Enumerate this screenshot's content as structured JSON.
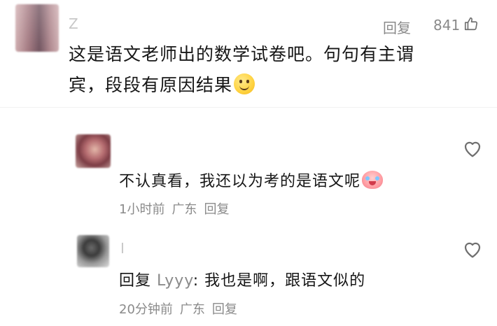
{
  "top_comment": {
    "username": "Z",
    "text_line1": "这是语文老师出的数学试卷吧。句句有主谓",
    "text_line2": "宾，段段有原因结果",
    "emoji": "smile-emoji",
    "reply_label": "回复",
    "like_count": "841",
    "like_icon": "thumb-up-icon"
  },
  "replies": [
    {
      "username": "",
      "text": "不认真看，我还以为考的是语文呢",
      "emoji": "crying-emoji",
      "time": "1小时前",
      "location": "广东",
      "reply_label": "回复",
      "like_icon": "heart-icon"
    },
    {
      "username": "I",
      "reply_prefix": "回复",
      "reply_to": "Lyyy",
      "text": ": 我也是啊，跟语文似的",
      "time": "20分钟前",
      "location": "广东",
      "reply_label": "回复",
      "like_icon": "heart-icon"
    }
  ],
  "colors": {
    "meta_gray": "#8a8a8a",
    "text": "#161616"
  }
}
